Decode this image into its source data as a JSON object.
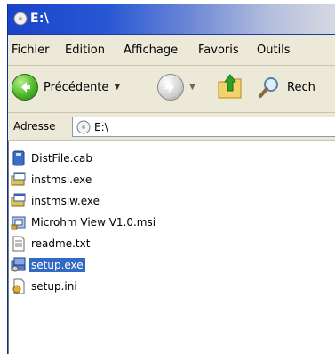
{
  "window": {
    "title": "E:\\"
  },
  "menu": [
    {
      "label": "Fichier",
      "ul": "F"
    },
    {
      "label": "Edition",
      "ul": "E"
    },
    {
      "label": "Affichage",
      "ul": "h"
    },
    {
      "label": "Favoris",
      "ul": "v"
    },
    {
      "label": "Outils",
      "ul": "O"
    }
  ],
  "toolbar": {
    "back_label": "Précédente",
    "search_label": "Rech"
  },
  "address": {
    "label": "Adresse",
    "value": "E:\\"
  },
  "files": [
    {
      "name": "DistFile.cab",
      "icon": "cab-icon",
      "selected": false
    },
    {
      "name": "instmsi.exe",
      "icon": "installer-exe-icon",
      "selected": false
    },
    {
      "name": "instmsiw.exe",
      "icon": "installer-exe-icon",
      "selected": false
    },
    {
      "name": "Microhm View V1.0.msi",
      "icon": "msi-package-icon",
      "selected": false
    },
    {
      "name": "readme.txt",
      "icon": "text-file-icon",
      "selected": false
    },
    {
      "name": "setup.exe",
      "icon": "setup-exe-icon",
      "selected": true
    },
    {
      "name": "setup.ini",
      "icon": "ini-file-icon",
      "selected": false
    }
  ],
  "colors": {
    "title_bar": "#2757d4",
    "selection": "#316ac5",
    "chrome": "#ece9d8"
  }
}
